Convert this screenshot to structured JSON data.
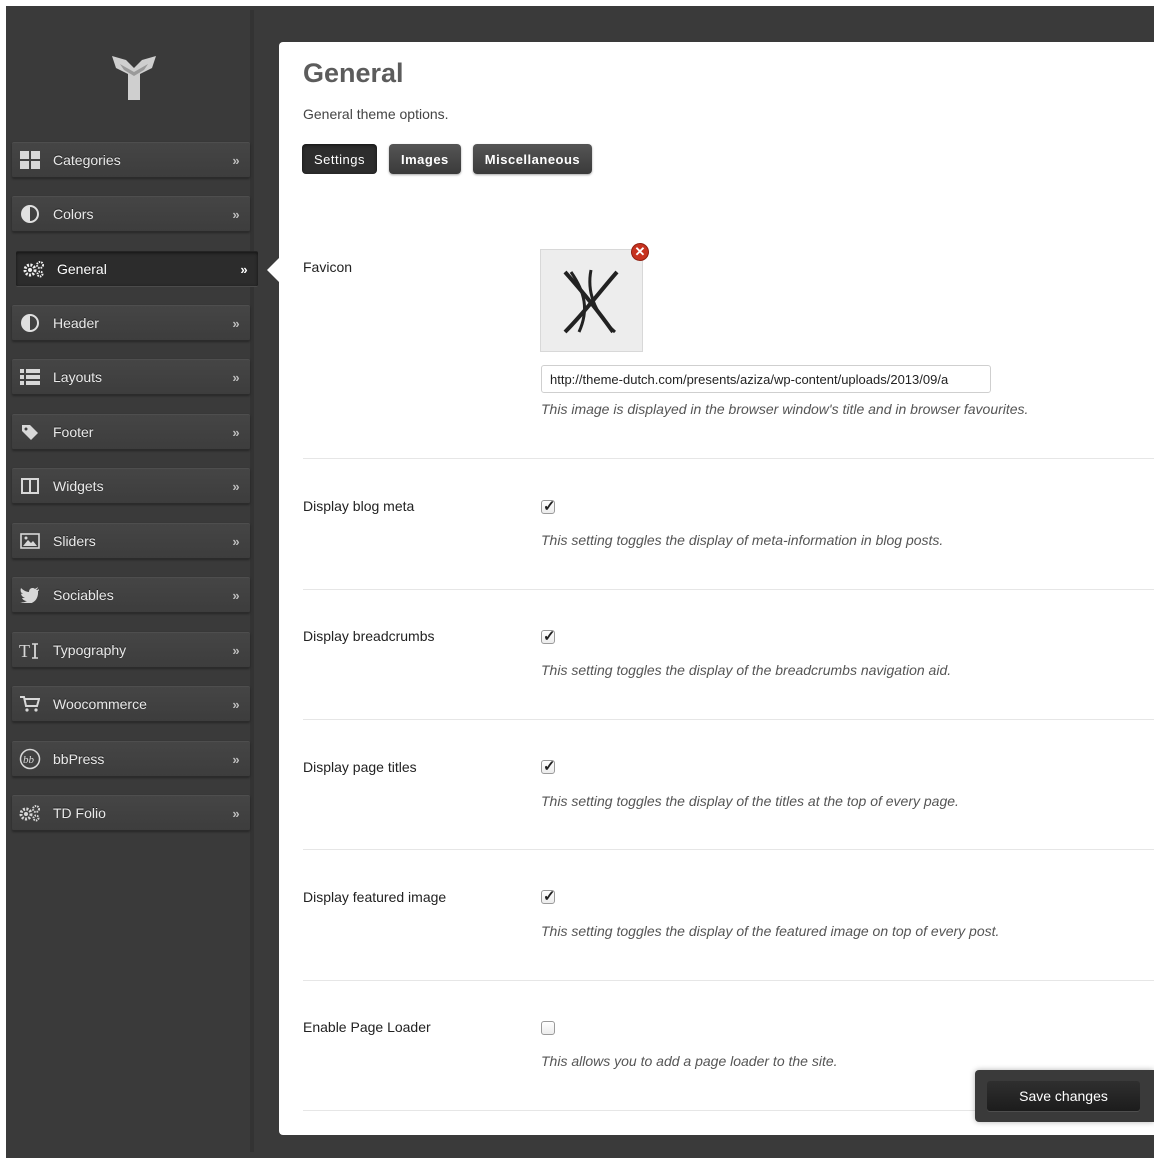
{
  "sidebar": {
    "items": [
      {
        "label": "Categories",
        "icon": "grid-icon"
      },
      {
        "label": "Colors",
        "icon": "contrast-icon"
      },
      {
        "label": "General",
        "icon": "gears-icon",
        "active": true
      },
      {
        "label": "Header",
        "icon": "contrast-icon"
      },
      {
        "label": "Layouts",
        "icon": "list-icon"
      },
      {
        "label": "Footer",
        "icon": "tag-icon"
      },
      {
        "label": "Widgets",
        "icon": "columns-icon"
      },
      {
        "label": "Sliders",
        "icon": "image-icon"
      },
      {
        "label": "Sociables",
        "icon": "twitter-bird-icon"
      },
      {
        "label": "Typography",
        "icon": "typography-icon"
      },
      {
        "label": "Woocommerce",
        "icon": "cart-icon"
      },
      {
        "label": "bbPress",
        "icon": "bbpress-icon"
      },
      {
        "label": "TD Folio",
        "icon": "gears-icon"
      }
    ],
    "chevron": "»"
  },
  "main": {
    "title": "General",
    "subtitle": "General theme options.",
    "tabs": [
      {
        "label": "Settings",
        "active": true
      },
      {
        "label": "Images"
      },
      {
        "label": "Miscellaneous"
      }
    ]
  },
  "favicon": {
    "label": "Favicon",
    "url": "http://theme-dutch.com/presents/aziza/wp-content/uploads/2013/09/a",
    "description": "This image is displayed in the browser window's title and in browser favourites.",
    "remove_glyph": "✕"
  },
  "settings": [
    {
      "label": "Display blog meta",
      "checked": true,
      "description": "This setting toggles the display of meta-information in blog posts."
    },
    {
      "label": "Display breadcrumbs",
      "checked": true,
      "description": "This setting toggles the display of the breadcrumbs navigation aid."
    },
    {
      "label": "Display page titles",
      "checked": true,
      "description": "This setting toggles the display of the titles at the top of every page."
    },
    {
      "label": "Display featured image",
      "checked": true,
      "description": "This setting toggles the display of the featured image on top of every post."
    },
    {
      "label": "Enable Page Loader",
      "checked": false,
      "description": "This allows you to add a page loader to the site."
    }
  ],
  "save": {
    "label": "Save changes"
  },
  "colors": {
    "sidebar_bg": "#3a3a3a",
    "panel_bg": "#ffffff",
    "remove": "#c7321f"
  }
}
